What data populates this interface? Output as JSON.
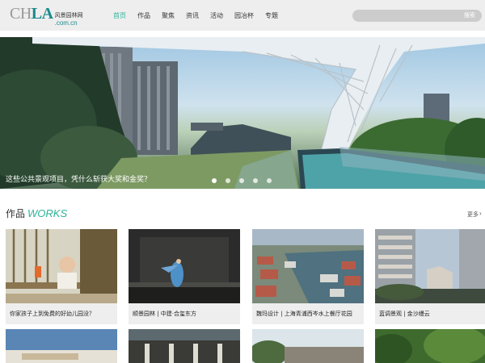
{
  "header": {
    "logo": {
      "ch": "CH",
      "la": "LA",
      "cn": "风景园林网",
      "domain": ".com.cn"
    },
    "nav": [
      "首页",
      "作品",
      "聚焦",
      "资讯",
      "活动",
      "园冶杯",
      "专题"
    ],
    "search": {
      "placeholder": "",
      "button": "搜索"
    }
  },
  "banner": {
    "caption": "这些公共景观项目，凭什么斩获大奖和金奖？",
    "slides": 5,
    "active_slide": 1
  },
  "works": {
    "title_cn": "作品",
    "title_en": "WORKS",
    "more": "更多",
    "cards": [
      {
        "caption": "你家孩子上到免费的好幼儿园没？"
      },
      {
        "caption": "顺景园林 | 中建·合玺东方"
      },
      {
        "caption": "魏玛设计 | 上海青浦西岑水上餐厅花园"
      },
      {
        "caption": "蓝调景观 | 金沙缦云"
      }
    ]
  },
  "colors": {
    "accent": "#2bb39a",
    "header_bg": "#eeeeee",
    "card_caption_bg": "#eeeeee"
  }
}
